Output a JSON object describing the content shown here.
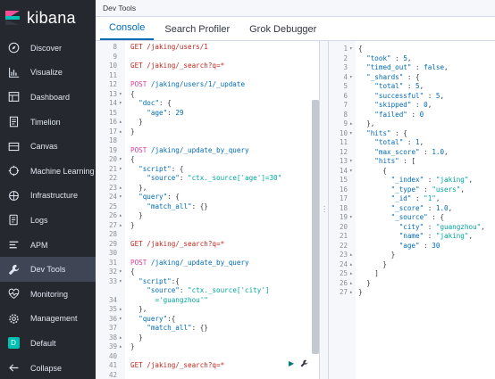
{
  "brand": {
    "name": "kibana"
  },
  "header": {
    "title": "Dev Tools"
  },
  "tabs": [
    {
      "label": "Console",
      "active": true
    },
    {
      "label": "Search Profiler",
      "active": false
    },
    {
      "label": "Grok Debugger",
      "active": false
    }
  ],
  "sidebar": {
    "items": [
      {
        "label": "Discover",
        "icon": "compass-icon"
      },
      {
        "label": "Visualize",
        "icon": "chart-icon"
      },
      {
        "label": "Dashboard",
        "icon": "dashboard-icon"
      },
      {
        "label": "Timelion",
        "icon": "timelion-icon"
      },
      {
        "label": "Canvas",
        "icon": "canvas-icon"
      },
      {
        "label": "Machine Learning",
        "icon": "ml-icon"
      },
      {
        "label": "Infrastructure",
        "icon": "infra-icon"
      },
      {
        "label": "Logs",
        "icon": "logs-icon"
      },
      {
        "label": "APM",
        "icon": "apm-icon"
      },
      {
        "label": "Dev Tools",
        "icon": "wrench-icon",
        "active": true
      },
      {
        "label": "Monitoring",
        "icon": "heartbeat-icon"
      },
      {
        "label": "Management",
        "icon": "gear-icon"
      },
      {
        "label": "Default",
        "icon": "space-avatar",
        "avatar_letter": "D"
      },
      {
        "label": "Collapse",
        "icon": "arrow-left-icon"
      }
    ]
  },
  "editor": {
    "lines": [
      {
        "n": "",
        "fold": "",
        "html": "<span class='err'>GET /jaking/users/1</span>"
      },
      {
        "n": "9",
        "fold": "",
        "html": ""
      },
      {
        "n": "",
        "fold": "",
        "html": "<span class='err'>GET /jaking/_search?q=*</span>"
      },
      {
        "n": "",
        "fold": "",
        "html": ""
      },
      {
        "n": "",
        "fold": "",
        "html": "<span class='kw'>POST</span> <span class='key'>/jaking/users/1/_update</span>"
      },
      {
        "n": "",
        "fold": "▾",
        "html": "{"
      },
      {
        "n": "",
        "fold": "▾",
        "html": "  <span class='key'>\"doc\"</span>: {"
      },
      {
        "n": "",
        "fold": "",
        "html": "    <span class='key'>\"age\"</span>: <span class='num'>29</span>"
      },
      {
        "n": "",
        "fold": "▴",
        "html": "  }"
      },
      {
        "n": "",
        "fold": "▴",
        "html": "}"
      },
      {
        "n": "",
        "fold": "",
        "html": ""
      },
      {
        "n": "",
        "fold": "",
        "html": "<span class='kw'>POST</span> <span class='key'>/jaking/_update_by_query</span>"
      },
      {
        "n": "",
        "fold": "▾",
        "html": "{"
      },
      {
        "n": "",
        "fold": "▾",
        "html": "  <span class='key'>\"script\"</span>: {"
      },
      {
        "n": "",
        "fold": "",
        "html": "    <span class='key'>\"source\"</span>: <span class='str'>\"ctx._source['age']=30\"</span>"
      },
      {
        "n": "",
        "fold": "▴",
        "html": "  },"
      },
      {
        "n": "",
        "fold": "▾",
        "html": "  <span class='key'>\"query\"</span>: {"
      },
      {
        "n": "",
        "fold": "",
        "html": "    <span class='key'>\"match_all\"</span>: {}"
      },
      {
        "n": "",
        "fold": "▴",
        "html": "  }"
      },
      {
        "n": "",
        "fold": "▴",
        "html": "}"
      },
      {
        "n": "",
        "fold": "",
        "html": ""
      },
      {
        "n": "",
        "fold": "",
        "html": "<span class='err'>GET /jaking/_search?q=*</span>"
      },
      {
        "n": "",
        "fold": "",
        "html": ""
      },
      {
        "n": "",
        "fold": "",
        "html": "<span class='kw'>POST</span> <span class='key'>/jaking/_update_by_query</span>"
      },
      {
        "n": "",
        "fold": "▾",
        "html": "{"
      },
      {
        "n": "",
        "fold": "▾",
        "html": "  <span class='key'>\"script\"</span>:{"
      },
      {
        "n": "",
        "fold": "",
        "html": "    <span class='key'>\"source\"</span>: <span class='str'>\"ctx._source['city']</span>"
      },
      {
        "n": "",
        "fold": "",
        "html": "      <span class='str'>='guangzhou'\"</span>"
      },
      {
        "n": "",
        "fold": "▴",
        "html": "  },"
      },
      {
        "n": "",
        "fold": "▾",
        "html": "  <span class='key'>\"query\"</span>:{"
      },
      {
        "n": "",
        "fold": "",
        "html": "    <span class='key'>\"match_all\"</span>: {}"
      },
      {
        "n": "",
        "fold": "▴",
        "html": "  }"
      },
      {
        "n": "",
        "fold": "▴",
        "html": "}"
      },
      {
        "n": "",
        "fold": "",
        "html": ""
      },
      {
        "n": "",
        "fold": "",
        "html": "<span class='err'>GET /jaking/_search?q=*</span>"
      },
      {
        "n": "",
        "fold": "",
        "html": ""
      }
    ],
    "numbers": [
      "8",
      "9",
      "10",
      "11",
      "12",
      "13",
      "14",
      "15",
      "16",
      "17",
      "18",
      "19",
      "20",
      "21",
      "22",
      "23",
      "24",
      "25",
      "26",
      "27",
      "28",
      "29",
      "30",
      "31",
      "32",
      "33",
      "",
      "34",
      "35",
      "36",
      "37",
      "38",
      "39",
      "40",
      "41",
      "42"
    ]
  },
  "output": {
    "numbers": [
      "1",
      "2",
      "3",
      "4",
      "5",
      "6",
      "7",
      "8",
      "9",
      "10",
      "11",
      "12",
      "13",
      "14",
      "15",
      "16",
      "17",
      "18",
      "19",
      "20",
      "21",
      "22",
      "23",
      "24",
      "25",
      "26",
      "27"
    ],
    "folds": [
      "▾",
      "",
      "",
      "▾",
      "",
      "",
      "",
      "",
      "▴",
      "▾",
      "",
      "",
      "▾",
      "▾",
      "",
      "",
      "",
      "",
      "▾",
      "",
      "",
      "",
      "▴",
      "▴",
      "▴",
      "▴",
      "▴"
    ],
    "lines": [
      "{",
      "  <span class='key'>\"took\"</span> : <span class='num'>5</span>,",
      "  <span class='key'>\"timed_out\"</span> : <span class='num'>false</span>,",
      "  <span class='key'>\"_shards\"</span> : {",
      "    <span class='key'>\"total\"</span> : <span class='num'>5</span>,",
      "    <span class='key'>\"successful\"</span> : <span class='num'>5</span>,",
      "    <span class='key'>\"skipped\"</span> : <span class='num'>0</span>,",
      "    <span class='key'>\"failed\"</span> : <span class='num'>0</span>",
      "  },",
      "  <span class='key'>\"hits\"</span> : {",
      "    <span class='key'>\"total\"</span> : <span class='num'>1</span>,",
      "    <span class='key'>\"max_score\"</span> : <span class='num'>1.0</span>,",
      "    <span class='key'>\"hits\"</span> : [",
      "      {",
      "        <span class='key'>\"_index\"</span> : <span class='str'>\"jaking\"</span>,",
      "        <span class='key'>\"_type\"</span> : <span class='str'>\"users\"</span>,",
      "        <span class='key'>\"_id\"</span> : <span class='str'>\"1\"</span>,",
      "        <span class='key'>\"_score\"</span> : <span class='num'>1.0</span>,",
      "        <span class='key'>\"_source\"</span> : {",
      "          <span class='key'>\"city\"</span> : <span class='str'>\"guangzhou\"</span>,",
      "          <span class='key'>\"name\"</span> : <span class='str'>\"jaking\"</span>,",
      "          <span class='key'>\"age\"</span> : <span class='num'>30</span>",
      "        }",
      "      }",
      "    ]",
      "  }",
      "}"
    ]
  }
}
